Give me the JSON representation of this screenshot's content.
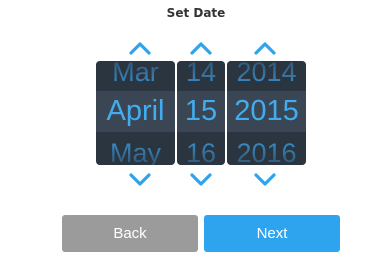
{
  "dialog": {
    "title": "Set Date"
  },
  "picker": {
    "month": {
      "prev": "Mar",
      "selected": "April",
      "next": "May"
    },
    "day": {
      "prev": "14",
      "selected": "15",
      "next": "16"
    },
    "year": {
      "prev": "2014",
      "selected": "2015",
      "next": "2016"
    }
  },
  "buttons": {
    "back_label": "Back",
    "next_label": "Next"
  },
  "colors": {
    "accent": "#2ea4ee",
    "wheel_bg": "#2b3540",
    "selected_band": "#3a4654",
    "back_button": "#9b9b9b",
    "next_button": "#2ea4ee"
  },
  "icons": {
    "up": "chevron-up-icon",
    "down": "chevron-down-icon"
  }
}
